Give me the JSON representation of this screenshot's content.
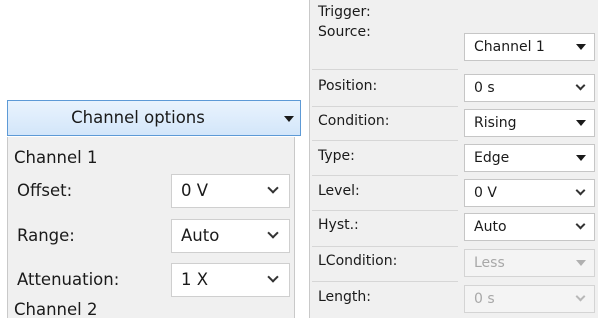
{
  "channel_options": {
    "header_label": "Channel options",
    "channels": [
      {
        "title": "Channel 1",
        "rows": [
          {
            "label": "Offset:",
            "value": "0 V"
          },
          {
            "label": "Range:",
            "value": "Auto"
          },
          {
            "label": "Attenuation:",
            "value": "1 X"
          }
        ]
      },
      {
        "title": "Channel 2"
      }
    ]
  },
  "trigger": {
    "title": "Trigger:",
    "rows": [
      {
        "label": "Source:",
        "value": "Channel 1",
        "control": "dropdown"
      },
      {
        "label": "Position:",
        "value": "0 s",
        "control": "combo"
      },
      {
        "label": "Condition:",
        "value": "Rising",
        "control": "dropdown"
      },
      {
        "label": "Type:",
        "value": "Edge",
        "control": "dropdown"
      },
      {
        "label": "Level:",
        "value": "0 V",
        "control": "combo"
      },
      {
        "label": "Hyst.:",
        "value": "Auto",
        "control": "combo"
      },
      {
        "label": "LCondition:",
        "value": "Less",
        "control": "dropdown",
        "disabled": true
      },
      {
        "label": "Length:",
        "value": "0 s",
        "control": "combo",
        "disabled": true
      }
    ]
  }
}
